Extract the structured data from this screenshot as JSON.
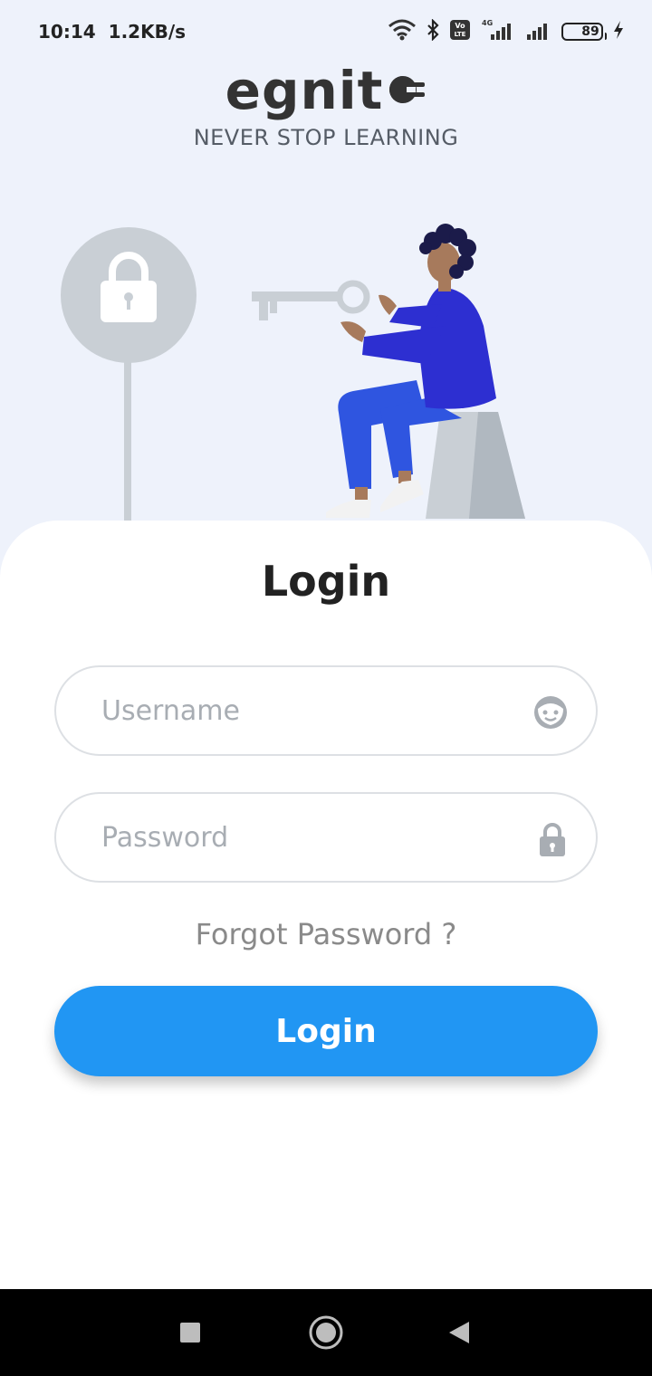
{
  "status_bar": {
    "time": "10:14",
    "net_speed": "1.2KB/s",
    "network_type": "4G",
    "battery_level": "89",
    "icons": [
      "wifi-icon",
      "bluetooth-icon",
      "volte-icon",
      "signal-icon",
      "signal-icon",
      "battery-icon",
      "charging-icon"
    ]
  },
  "brand": {
    "logo_text": "egnit",
    "tagline": "NEVER STOP LEARNING"
  },
  "login": {
    "title": "Login",
    "username_placeholder": "Username",
    "password_placeholder": "Password",
    "forgot_label": "Forgot Password ?",
    "submit_label": "Login"
  },
  "nav": {
    "icons": [
      "recents-icon",
      "home-icon",
      "back-icon"
    ]
  },
  "colors": {
    "background": "#EEF2FB",
    "card": "#FFFFFF",
    "primary": "#2196F3",
    "figure_shirt": "#2D2FD1",
    "figure_pants": "#2F55E0",
    "lock_grey": "#C9CFD5"
  }
}
